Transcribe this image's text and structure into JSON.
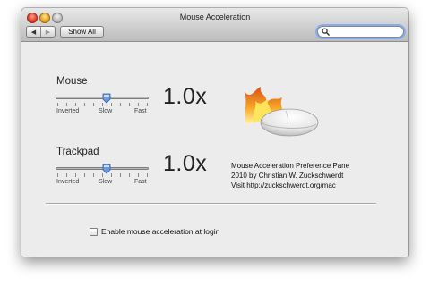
{
  "window": {
    "title": "Mouse Acceleration"
  },
  "toolbar": {
    "back_icon": "back-arrow-icon",
    "forward_icon": "forward-arrow-icon",
    "show_all_label": "Show All",
    "search_value": "",
    "search_icon": "magnifier-icon"
  },
  "mouse": {
    "label": "Mouse",
    "value_display": "1.0x",
    "slider_level": 0.55,
    "scale": {
      "min": "Inverted",
      "mid": "Slow",
      "max": "Fast"
    }
  },
  "trackpad": {
    "label": "Trackpad",
    "value_display": "1.0x",
    "slider_level": 0.55,
    "scale": {
      "min": "Inverted",
      "mid": "Slow",
      "max": "Fast"
    }
  },
  "about": {
    "line1": "Mouse Acceleration Preference Pane",
    "line2": "2010 by Christian W. Zuckschwerdt",
    "line3": "Visit http://zuckschwerdt.org/mac"
  },
  "login_option": {
    "label": "Enable mouse acceleration at login",
    "checked": false
  },
  "colors": {
    "search_focus": "#84aef0",
    "flame": "#f7a21b",
    "thumb": "#6a9be0"
  }
}
